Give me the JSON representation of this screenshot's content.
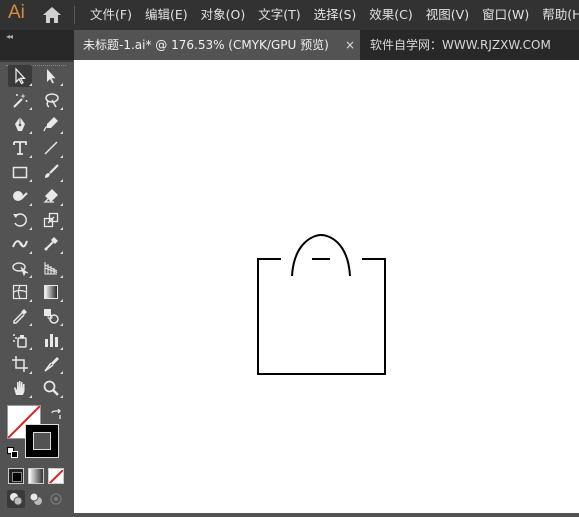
{
  "app": {
    "logo_text": "Ai"
  },
  "menu": [
    "文件(F)",
    "编辑(E)",
    "对象(O)",
    "文字(T)",
    "选择(S)",
    "效果(C)",
    "视图(V)",
    "窗口(W)",
    "帮助(H)"
  ],
  "tabs": {
    "active_title": "未标题-1.ai* @ 176.53% (CMYK/GPU 预览)",
    "close_glyph": "×",
    "other_title": "软件自学网：WWW.RJZXW.COM"
  },
  "panel": {
    "collapse_glyph": "◂◂"
  },
  "tools": [
    [
      "selection-tool-icon",
      "direct-selection-tool-icon"
    ],
    [
      "magic-wand-tool-icon",
      "lasso-tool-icon"
    ],
    [
      "pen-tool-icon",
      "curvature-tool-icon"
    ],
    [
      "type-tool-icon",
      "line-segment-tool-icon"
    ],
    [
      "rectangle-tool-icon",
      "paintbrush-tool-icon"
    ],
    [
      "shaper-tool-icon",
      "eraser-tool-icon"
    ],
    [
      "rotate-tool-icon",
      "scale-tool-icon"
    ],
    [
      "width-tool-icon",
      "puppet-warp-tool-icon"
    ],
    [
      "shape-builder-tool-icon",
      "perspective-grid-tool-icon"
    ],
    [
      "mesh-tool-icon",
      "gradient-tool-icon"
    ],
    [
      "eyedropper-tool-icon",
      "blend-tool-icon"
    ],
    [
      "symbol-sprayer-tool-icon",
      "column-graph-tool-icon"
    ],
    [
      "artboard-tool-icon",
      "slice-tool-icon"
    ],
    [
      "hand-tool-icon",
      "zoom-tool-icon"
    ]
  ],
  "colors": {
    "fill": "none",
    "stroke": "#000000",
    "accent": "#d8893c"
  }
}
